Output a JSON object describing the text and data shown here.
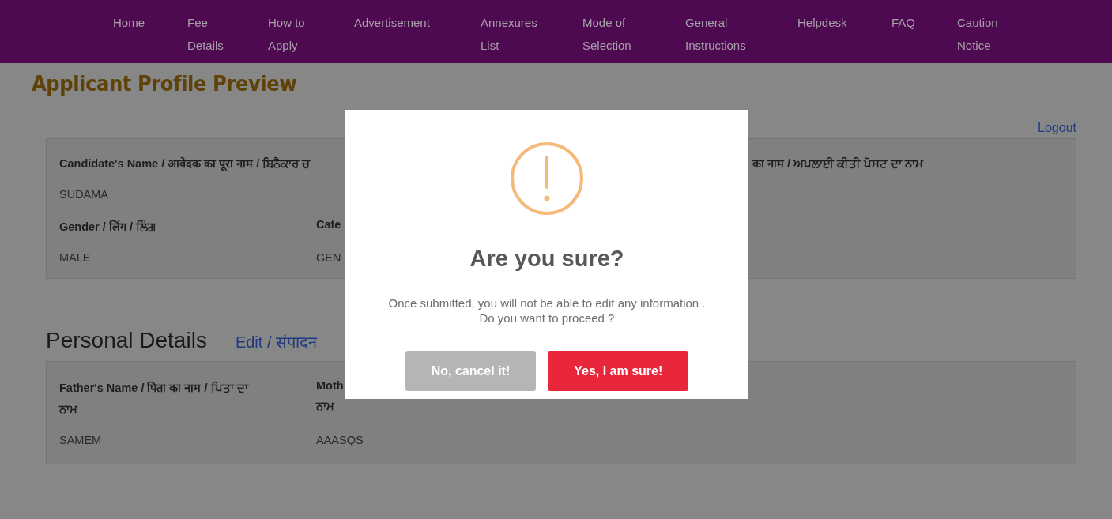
{
  "nav": [
    {
      "label": "Home"
    },
    {
      "label": "Fee Details"
    },
    {
      "label": "How to Apply"
    },
    {
      "label": "Advertisement"
    },
    {
      "label": "Annexures List"
    },
    {
      "label": "Mode of Selection"
    },
    {
      "label": "General Instructions"
    },
    {
      "label": "Helpdesk"
    },
    {
      "label": "FAQ"
    },
    {
      "label": "Caution Notice"
    }
  ],
  "page_title": "Applicant Profile Preview",
  "logout": "Logout",
  "profile_card": {
    "name_label": "Candidate's Name / आवेदक का पूरा नाम / ਬਿਨੈਕਾਰ ਚ",
    "post_label": "का नाम / ਅਪਲਾਈ ਕੀਤੀ ਪੋਸਟ ਦਾ ਨਾਮ",
    "name_value": "SUDAMA",
    "fields": [
      {
        "label": "Gender / लिंग / ਲਿੰਗ",
        "value": "MALE"
      },
      {
        "label": "Cate",
        "value": "GEN"
      }
    ]
  },
  "personal_details": {
    "heading": "Personal Details",
    "edit_link": "Edit / संपादन",
    "fields": [
      {
        "label_lines": [
          "Father's Name / पिता का नाम / ਪਿਤਾ ਦਾ",
          "ਨਾਮ"
        ],
        "value": "SAMEM"
      },
      {
        "label_lines": [
          "Moth",
          "ਨਾਮ"
        ],
        "value": "AAASQS"
      }
    ]
  },
  "dialog": {
    "title": "Are you sure?",
    "message_lines": [
      "Once submitted, you will not be able to edit any information .",
      "Do you want to proceed ?"
    ],
    "buttons": [
      {
        "label": "No, cancel it!",
        "kind": "cancel"
      },
      {
        "label": "Yes, I am sure!",
        "kind": "confirm"
      }
    ]
  }
}
